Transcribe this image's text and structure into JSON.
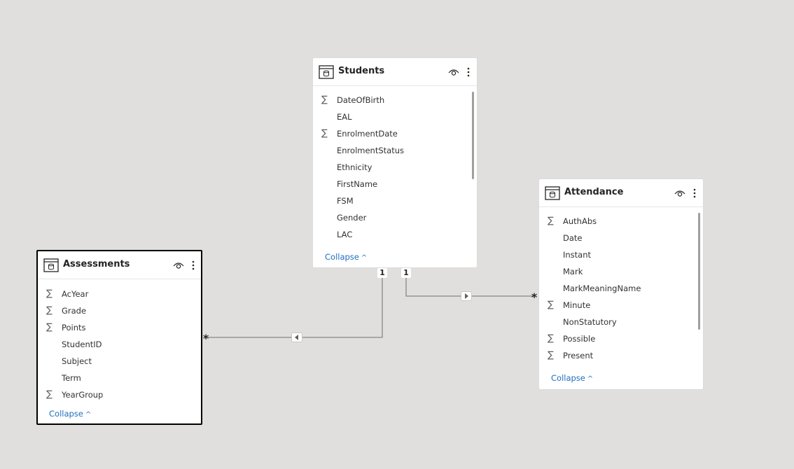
{
  "tables": {
    "students": {
      "title": "Students",
      "fields": [
        {
          "name": "DateOfBirth",
          "sum": true
        },
        {
          "name": "EAL",
          "sum": false
        },
        {
          "name": "EnrolmentDate",
          "sum": true
        },
        {
          "name": "EnrolmentStatus",
          "sum": false
        },
        {
          "name": "Ethnicity",
          "sum": false
        },
        {
          "name": "FirstName",
          "sum": false
        },
        {
          "name": "FSM",
          "sum": false
        },
        {
          "name": "Gender",
          "sum": false
        },
        {
          "name": "LAC",
          "sum": false
        }
      ],
      "collapse_label": "Collapse"
    },
    "assessments": {
      "title": "Assessments",
      "fields": [
        {
          "name": "AcYear",
          "sum": true
        },
        {
          "name": "Grade",
          "sum": true
        },
        {
          "name": "Points",
          "sum": true
        },
        {
          "name": "StudentID",
          "sum": false
        },
        {
          "name": "Subject",
          "sum": false
        },
        {
          "name": "Term",
          "sum": false
        },
        {
          "name": "YearGroup",
          "sum": true
        }
      ],
      "collapse_label": "Collapse"
    },
    "attendance": {
      "title": "Attendance",
      "fields": [
        {
          "name": "AuthAbs",
          "sum": true
        },
        {
          "name": "Date",
          "sum": false
        },
        {
          "name": "Instant",
          "sum": false
        },
        {
          "name": "Mark",
          "sum": false
        },
        {
          "name": "MarkMeaningName",
          "sum": false
        },
        {
          "name": "Minute",
          "sum": true
        },
        {
          "name": "NonStatutory",
          "sum": false
        },
        {
          "name": "Possible",
          "sum": true
        },
        {
          "name": "Present",
          "sum": true
        }
      ],
      "collapse_label": "Collapse"
    }
  },
  "relationships": {
    "students_assessments": {
      "one": "1",
      "many": "*"
    },
    "students_attendance": {
      "one": "1",
      "many": "*"
    }
  },
  "symbols": {
    "sum": "∑",
    "chevron_up": "^"
  },
  "colors": {
    "canvas": "#e1dfdd",
    "link": "#1f6ebe",
    "line": "#8a8886",
    "selected_border": "#000000"
  }
}
